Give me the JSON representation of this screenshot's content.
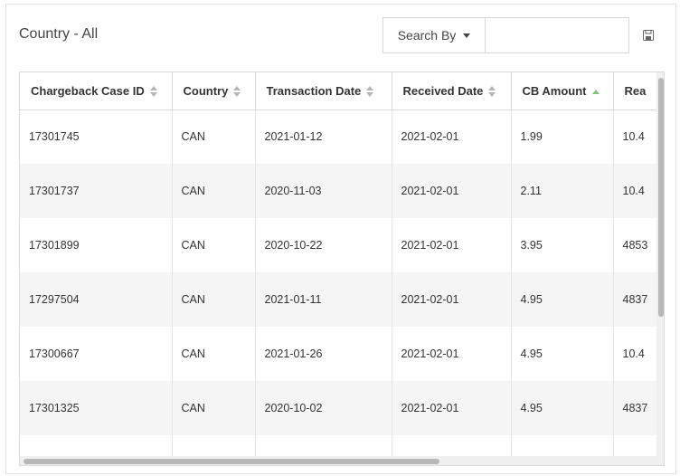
{
  "header": {
    "title": "Country - All"
  },
  "search": {
    "button_label": "Search By",
    "value": "",
    "placeholder": ""
  },
  "table": {
    "columns": [
      {
        "label": "Chargeback Case ID",
        "sort": "none"
      },
      {
        "label": "Country",
        "sort": "none"
      },
      {
        "label": "Transaction Date",
        "sort": "none"
      },
      {
        "label": "Received Date",
        "sort": "none"
      },
      {
        "label": "CB Amount",
        "sort": "asc"
      },
      {
        "label": "Rea",
        "sort": "none"
      }
    ],
    "rows": [
      [
        "17301745",
        "CAN",
        "2021-01-12",
        "2021-02-01",
        "1.99",
        "10.4"
      ],
      [
        "17301737",
        "CAN",
        "2020-11-03",
        "2021-02-01",
        "2.11",
        "10.4"
      ],
      [
        "17301899",
        "CAN",
        "2020-10-22",
        "2021-02-01",
        "3.95",
        "4853"
      ],
      [
        "17297504",
        "CAN",
        "2021-01-11",
        "2021-02-01",
        "4.95",
        "4837"
      ],
      [
        "17300667",
        "CAN",
        "2021-01-26",
        "2021-02-01",
        "4.95",
        "10.4"
      ],
      [
        "17301325",
        "CAN",
        "2020-10-02",
        "2021-02-01",
        "4.95",
        "4837"
      ],
      [
        "",
        "",
        "",
        "",
        "",
        ""
      ]
    ]
  },
  "colors": {
    "sort_active": "#7cc576",
    "sort_inactive": "#b5b5b5",
    "row_alt": "#f5f5f5"
  },
  "icons": {
    "save": "save-icon"
  }
}
